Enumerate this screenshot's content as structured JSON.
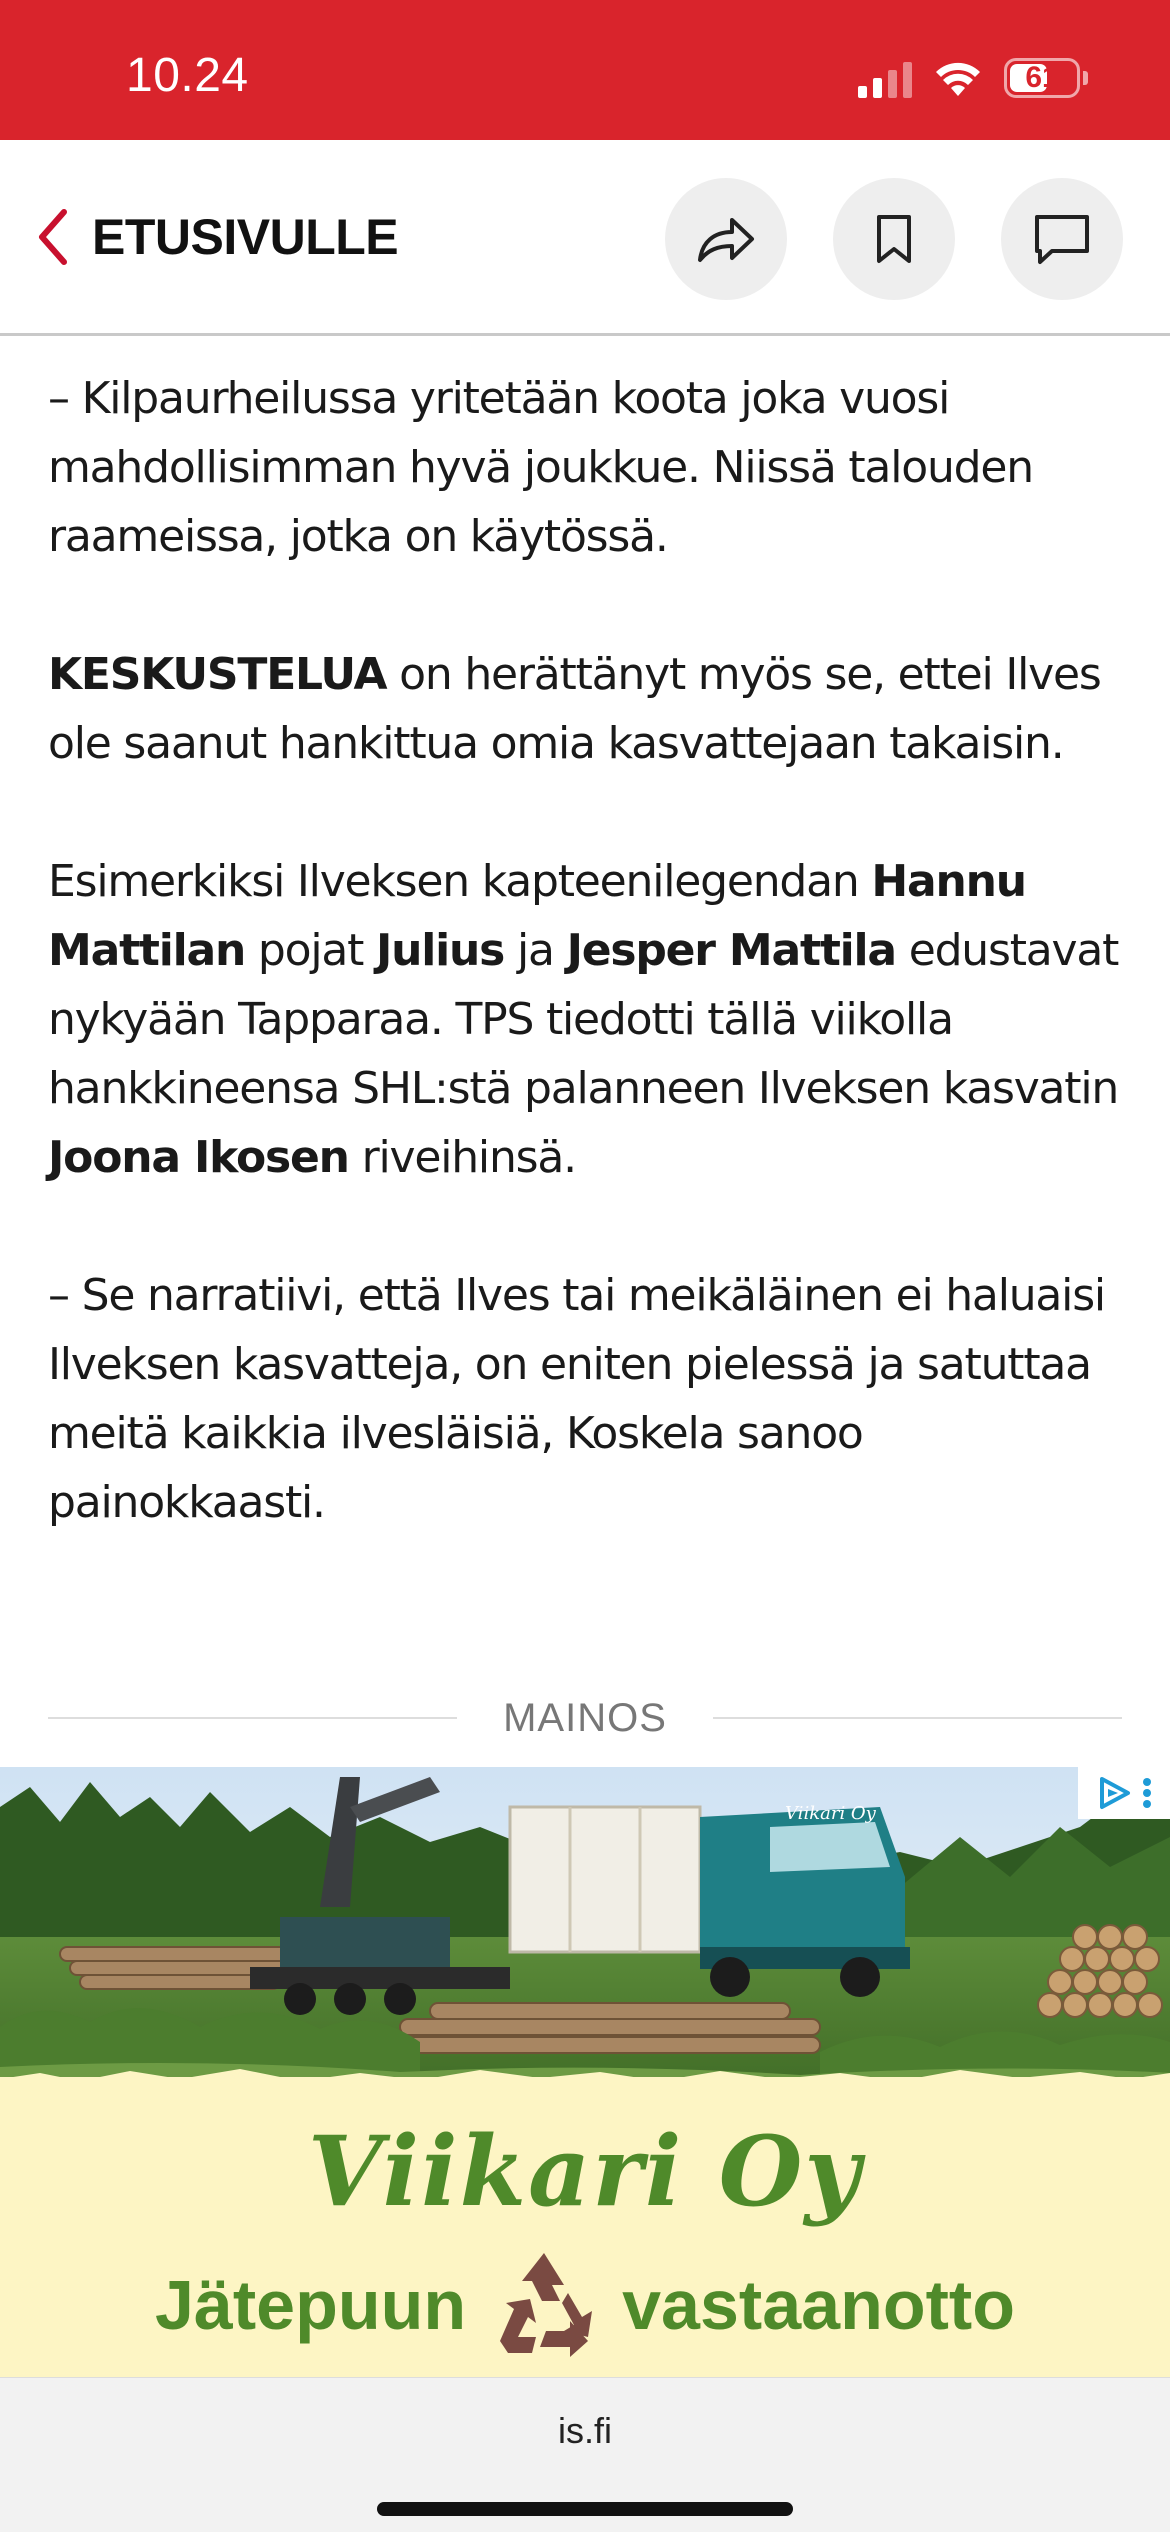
{
  "status_bar": {
    "time": "10.24",
    "battery_level": "61",
    "battery_fraction": 0.61,
    "signal_bars_active": 2,
    "signal_bars_total": 4,
    "background_color": "#d9242c"
  },
  "header": {
    "back_label": "ETUSIVULLE",
    "back_icon": "chevron-left-icon",
    "accent_color": "#c8102e",
    "actions": [
      {
        "icon": "share-icon"
      },
      {
        "icon": "bookmark-icon"
      },
      {
        "icon": "comment-icon"
      }
    ]
  },
  "article": {
    "p1": "– Kilpaurheilussa yritetään koota joka vuosi mahdollisimman hyvä joukkue. Niissä talouden raameissa, jotka on käytössä.",
    "p2_bold": "KESKUSTELUA",
    "p2_rest": " on herättänyt myös se, ettei Ilves ole saanut hankittua omia kasvattejaan takaisin.",
    "p3_a": "Esimerkiksi Ilveksen kapteenilegendan ",
    "p3_b_bold": "Hannu Mattilan",
    "p3_c": " pojat ",
    "p3_d_bold": "Julius",
    "p3_e": " ja ",
    "p3_f_bold": "Jesper Mattila",
    "p3_g": " edustavat nykyään Tapparaa. TPS tiedotti tällä viikolla hankkineensa SHL:stä palanneen Ilveksen kasvatin ",
    "p3_h_bold": "Joona Ikosen",
    "p3_i": " riveihinsä.",
    "p4": "– Se narratiivi, että Ilves tai meikäläinen ei haluaisi Ilveksen kasvatteja, on eniten pielessä ja satuttaa meitä kaikkia ilvesläisiä, Koskela sanoo painokkaasti."
  },
  "ad": {
    "label": "MAINOS",
    "brand": "Viikari Oy",
    "slogan_left": "Jätepuun",
    "slogan_right": "vastaanotto",
    "truck_text": "Viikari Oy",
    "recycle_icon": "recycle-icon",
    "choices_icon": "adchoices-icon",
    "green": "#4f8a2a",
    "cream": "#fdf5c4"
  },
  "browser": {
    "url": "is.fi"
  }
}
